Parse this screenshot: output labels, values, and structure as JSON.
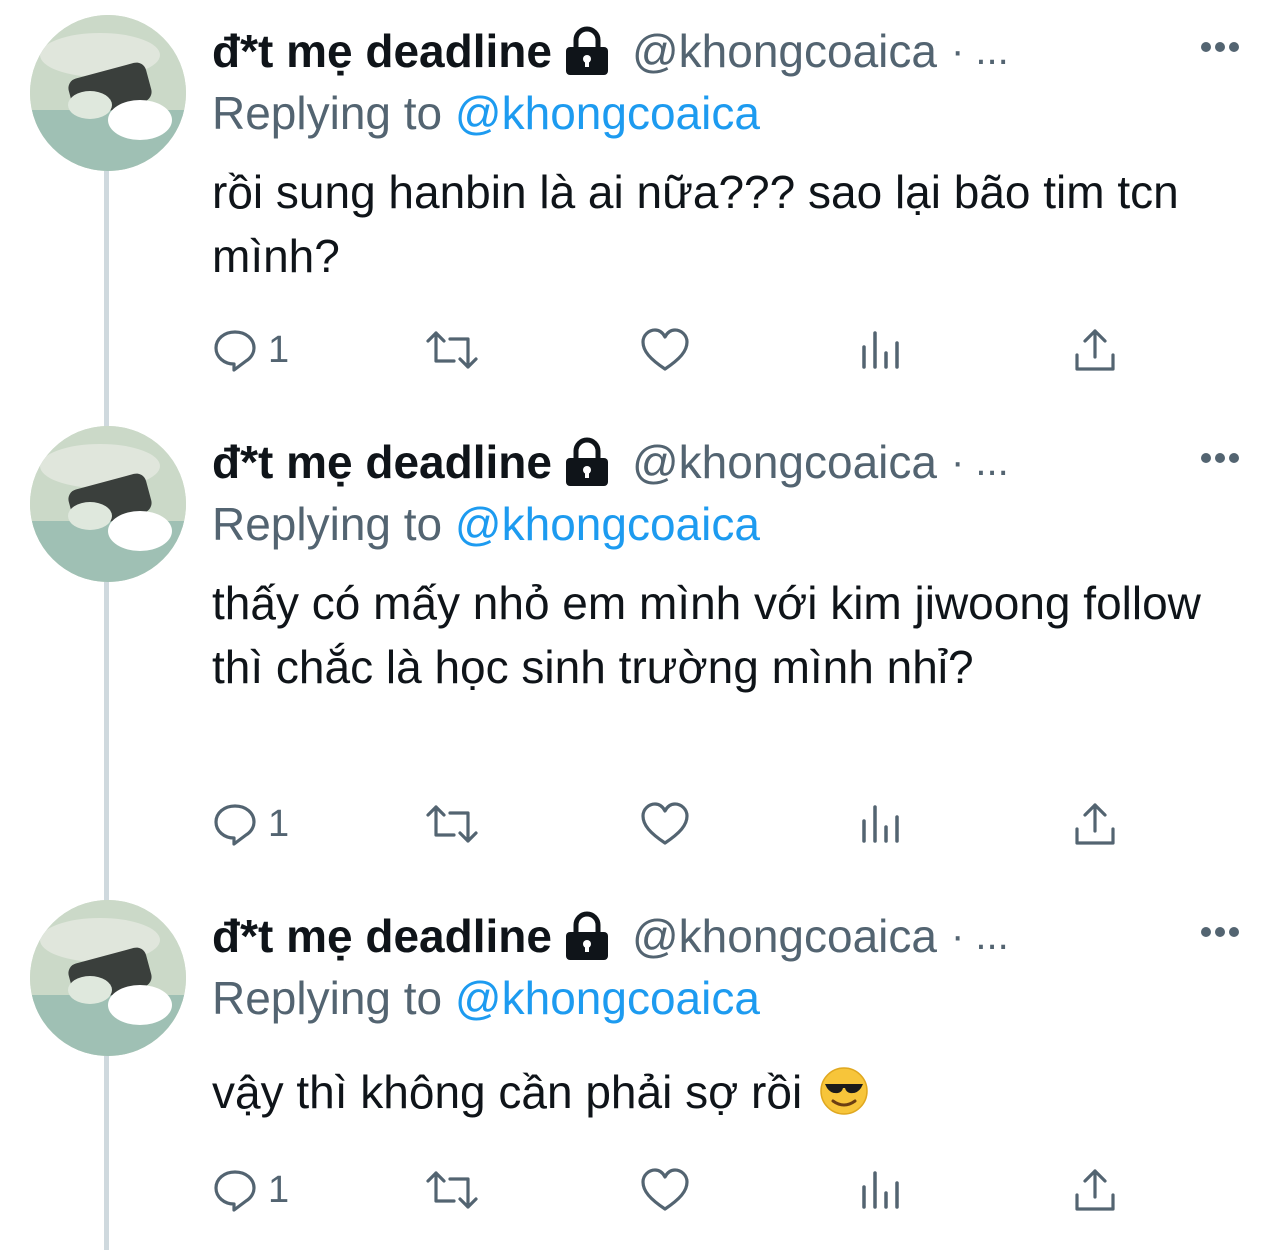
{
  "thread": {
    "tweets": [
      {
        "display_name": "đ*t mẹ deadline",
        "handle": "@khongcoaica",
        "dot_separator": "· ...",
        "replying_prefix": "Replying to",
        "replying_to": "@khongcoaica",
        "text": "rồi sung hanbin là ai nữa??? sao lại bão tim tcn mình?",
        "reply_count": "1",
        "has_emoji": false
      },
      {
        "display_name": "đ*t mẹ deadline",
        "handle": "@khongcoaica",
        "dot_separator": "· ...",
        "replying_prefix": "Replying to",
        "replying_to": "@khongcoaica",
        "text": "thấy có mấy nhỏ em mình với kim jiwoong follow thì chắc là học sinh trường mình nhỉ?",
        "reply_count": "1",
        "has_emoji": false
      },
      {
        "display_name": "đ*t mẹ deadline",
        "handle": "@khongcoaica",
        "dot_separator": "· ...",
        "replying_prefix": "Replying to",
        "replying_to": "@khongcoaica",
        "text": "vậy thì không cần phải sợ rồi",
        "reply_count": "1",
        "has_emoji": true,
        "emoji_name": "smiling-face-with-sunglasses"
      }
    ]
  },
  "icons": {
    "reply": "reply-icon",
    "retweet": "retweet-icon",
    "like": "heart-icon",
    "views": "views-icon",
    "share": "share-icon",
    "lock": "lock-icon",
    "more": "more-icon"
  },
  "colors": {
    "text_primary": "#0f1419",
    "text_secondary": "#536471",
    "mention": "#1d9bf0",
    "thread_line": "#cfd9de",
    "background": "#ffffff"
  }
}
